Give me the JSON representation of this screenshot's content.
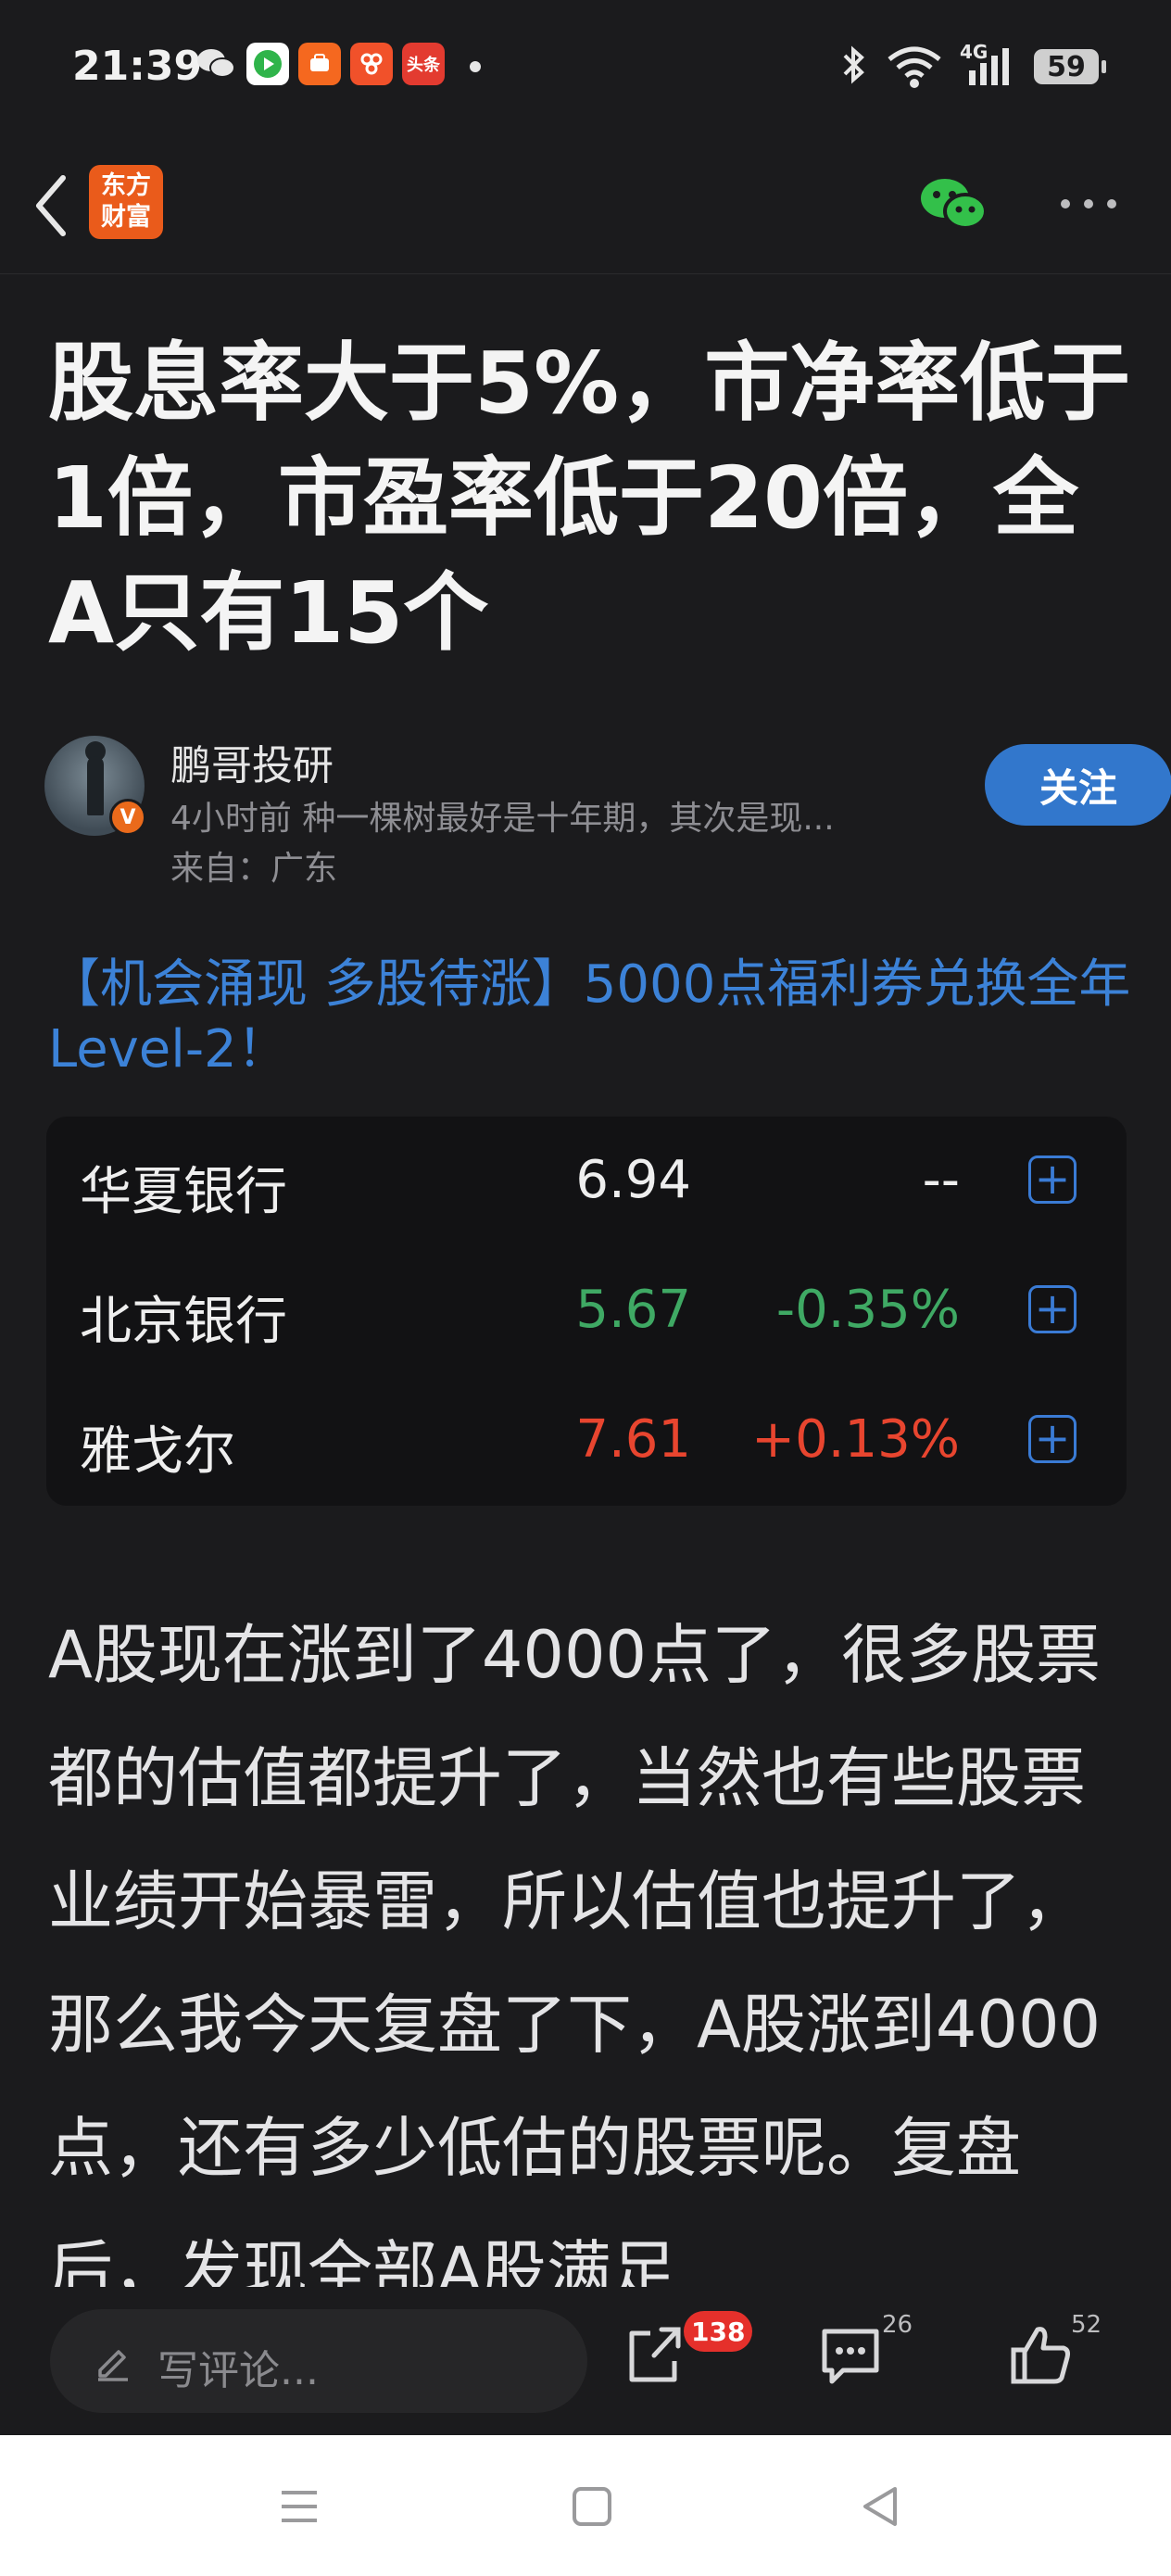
{
  "status_bar": {
    "time": "21:39",
    "notifications": [
      {
        "icon": "wechat-icon"
      },
      {
        "icon": "video-app-icon",
        "color": "#2fb44a"
      },
      {
        "icon": "taobao-icon",
        "color": "#f5681f"
      },
      {
        "icon": "shopping-app-icon",
        "color": "#f1512a"
      },
      {
        "icon": "toutiao-icon",
        "label": "头条",
        "color": "#e33b30"
      }
    ],
    "network": "4G",
    "battery": "59"
  },
  "header": {
    "logo_text": "东方财富",
    "logo_color": "#ea5b1b",
    "share_icon": "wechat-icon",
    "more_icon": "more-icon"
  },
  "article": {
    "title": "股息率大于5%，市净率低于1倍，市盈率低于20倍，全A只有15个",
    "author": {
      "name": "鹏哥投研",
      "meta": "4小时前 种一棵树最好是十年期，其次是现...",
      "location": "来自：广东",
      "verified_label": "V",
      "follow_label": "关注"
    },
    "promo": "【机会涌现 多股待涨】5000点福利券兑换全年Level-2！",
    "quotes": [
      {
        "name": "华夏银行",
        "price": "6.94",
        "change": "--",
        "price_color": "#eeeeee",
        "change_color": "#eeeeee"
      },
      {
        "name": "北京银行",
        "price": "5.67",
        "change": "-0.35%",
        "price_color": "#3fa964",
        "change_color": "#3fa964"
      },
      {
        "name": "雅戈尔",
        "price": "7.61",
        "change": "+0.13%",
        "price_color": "#e8452f",
        "change_color": "#e8452f"
      }
    ],
    "body": "A股现在涨到了4000点了，很多股票都的估值都提升了，当然也有些股票业绩开始暴雷，所以估值也提升了，那么我今天复盘了下，A股涨到4000点，还有多少低估的股票呢。复盘后，发现全部A股满足"
  },
  "bottom_bar": {
    "comment_placeholder": "写评论...",
    "share_count": "138",
    "comment_count": "26",
    "like_count": "52"
  }
}
